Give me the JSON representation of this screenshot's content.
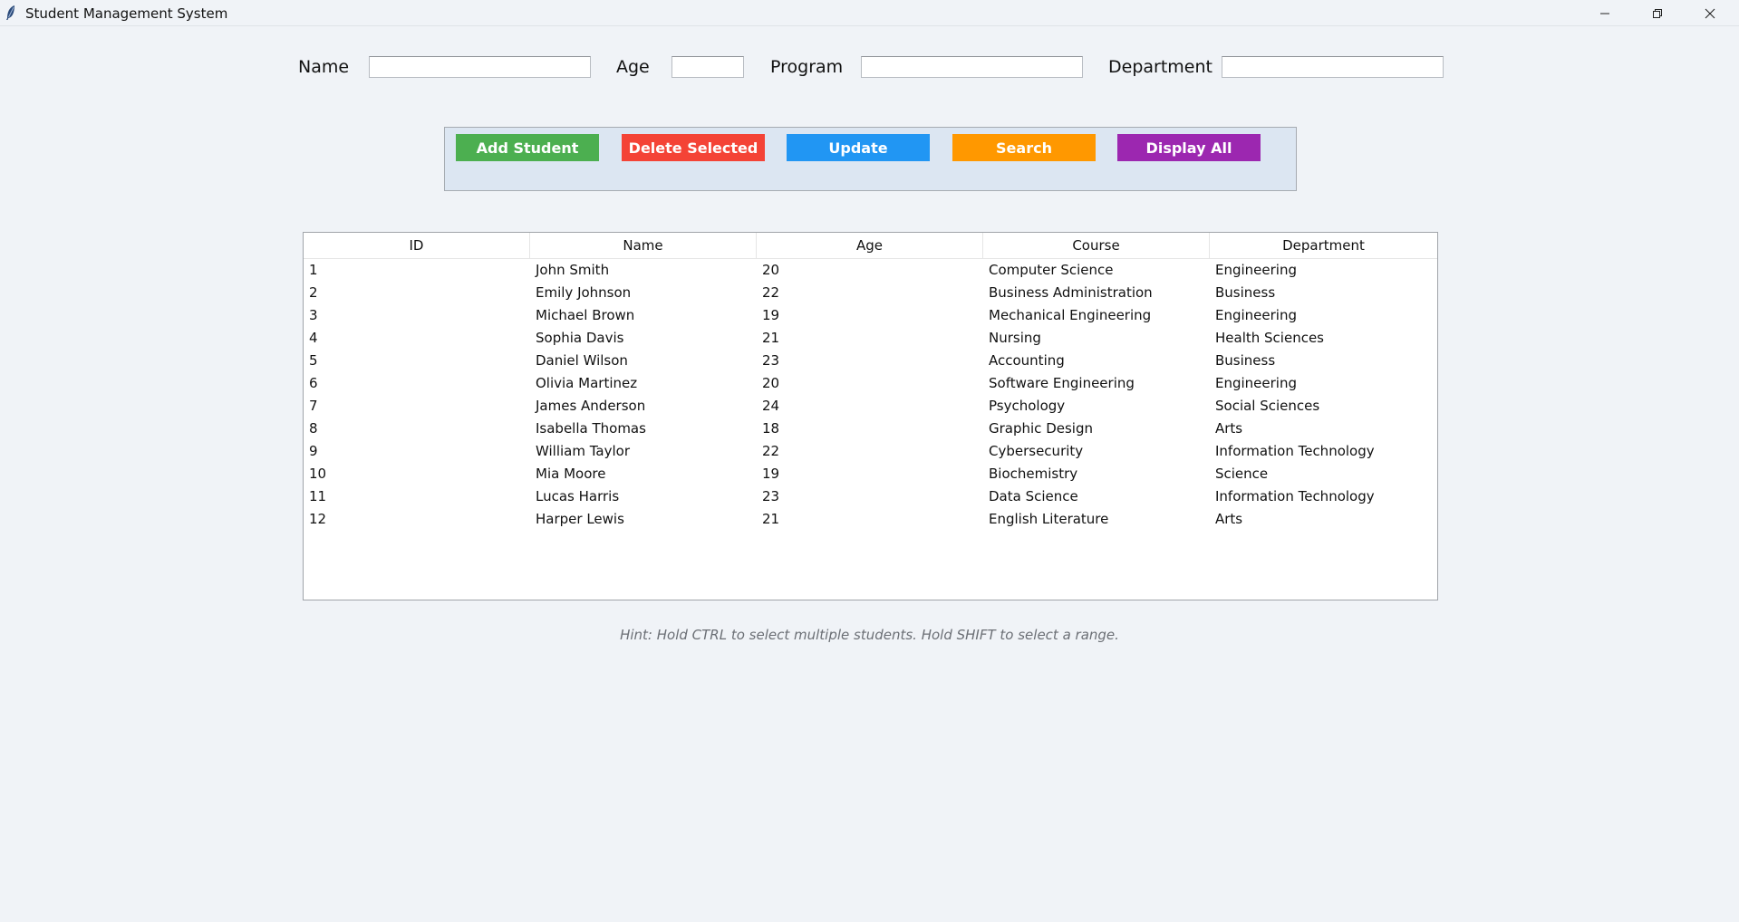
{
  "window": {
    "title": "Student Management System",
    "icon": "feather-icon",
    "controls": [
      "minimize-icon",
      "restore-icon",
      "close-icon"
    ]
  },
  "form": {
    "name_label": "Name",
    "name_value": "",
    "age_label": "Age",
    "age_value": "",
    "program_label": "Program",
    "program_value": "",
    "department_label": "Department",
    "department_value": ""
  },
  "buttons": {
    "add": {
      "label": "Add Student",
      "color": "#4caf50"
    },
    "delete": {
      "label": "Delete Selected",
      "color": "#f44336"
    },
    "update": {
      "label": "Update",
      "color": "#2196f3"
    },
    "search": {
      "label": "Search",
      "color": "#ff9800"
    },
    "display": {
      "label": "Display All",
      "color": "#9c27b0"
    }
  },
  "table": {
    "columns": [
      "ID",
      "Name",
      "Age",
      "Course",
      "Department"
    ],
    "rows": [
      [
        "1",
        "John Smith",
        "20",
        "Computer Science",
        "Engineering"
      ],
      [
        "2",
        "Emily Johnson",
        "22",
        "Business Administration",
        "Business"
      ],
      [
        "3",
        "Michael Brown",
        "19",
        "Mechanical Engineering",
        "Engineering"
      ],
      [
        "4",
        "Sophia Davis",
        "21",
        "Nursing",
        "Health Sciences"
      ],
      [
        "5",
        "Daniel Wilson",
        "23",
        "Accounting",
        "Business"
      ],
      [
        "6",
        "Olivia Martinez",
        "20",
        "Software Engineering",
        "Engineering"
      ],
      [
        "7",
        "James Anderson",
        "24",
        "Psychology",
        "Social Sciences"
      ],
      [
        "8",
        "Isabella Thomas",
        "18",
        "Graphic Design",
        "Arts"
      ],
      [
        "9",
        "William Taylor",
        "22",
        "Cybersecurity",
        "Information Technology"
      ],
      [
        "10",
        "Mia Moore",
        "19",
        "Biochemistry",
        "Science"
      ],
      [
        "11",
        "Lucas Harris",
        "23",
        "Data Science",
        "Information Technology"
      ],
      [
        "12",
        "Harper Lewis",
        "21",
        "English Literature",
        "Arts"
      ]
    ]
  },
  "hint": "Hint: Hold CTRL to select multiple students. Hold SHIFT to select a range."
}
